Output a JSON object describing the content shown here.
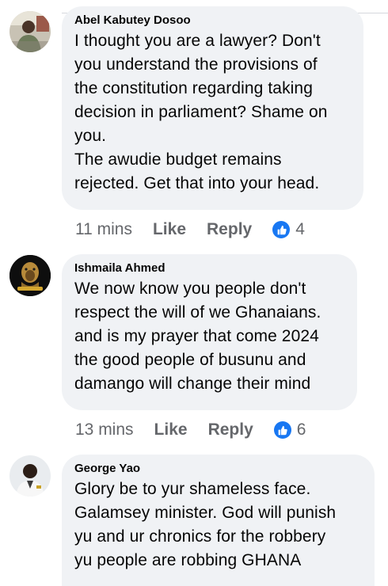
{
  "comments": [
    {
      "author": "Abel Kabutey Dosoo",
      "text": "I thought you are a lawyer? Don't\nyou understand the provisions of\nthe constitution regarding taking\ndecision in parliament? Shame on\nyou.\nThe awudie budget remains\nrejected. Get that into your head.",
      "time": "11 mins",
      "like_label": "Like",
      "reply_label": "Reply",
      "reaction_count": "4",
      "reaction_icon": "thumbs-up-icon"
    },
    {
      "author": "Ishmaila Ahmed",
      "text": "We now know you people don't\nrespect the will of we Ghanaians.\nand is my prayer that come 2024\nthe good people of busunu and\ndamango will change their mind",
      "time": "13 mins",
      "like_label": "Like",
      "reply_label": "Reply",
      "reaction_count": "6",
      "reaction_icon": "thumbs-up-icon"
    },
    {
      "author": "George Yao",
      "text": "Glory be to yur shameless face.\nGalamsey minister. God will punish\nyu and ur chronics for the robbery\nyu people are robbing GHANA",
      "reaction_icon": "thumbs-up-icon"
    }
  ],
  "colors": {
    "bubble_bg": "#f0f2f5",
    "meta_text": "#65676b",
    "reaction_blue": "#1877f2"
  }
}
